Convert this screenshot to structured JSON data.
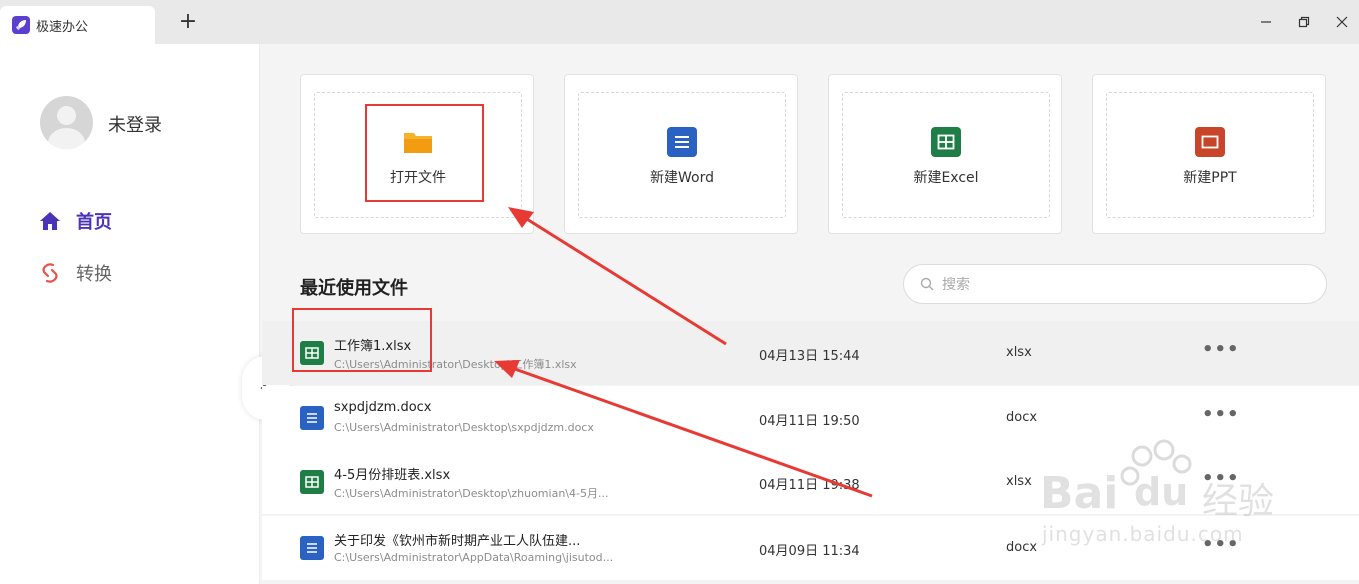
{
  "app": {
    "tab_title": "极速办公",
    "new_tab_label": "+"
  },
  "user": {
    "name": "未登录"
  },
  "nav": [
    {
      "label": "首页",
      "icon": "home-icon",
      "active": true
    },
    {
      "label": "转换",
      "icon": "convert-icon",
      "active": false
    }
  ],
  "cards": [
    {
      "label": "打开文件",
      "icon": "folder-icon",
      "color": "#f6a623"
    },
    {
      "label": "新建Word",
      "icon": "word-icon",
      "color": "#2a62c4"
    },
    {
      "label": "新建Excel",
      "icon": "excel-icon",
      "color": "#1e7e45"
    },
    {
      "label": "新建PPT",
      "icon": "ppt-icon",
      "color": "#c8452a"
    }
  ],
  "recent": {
    "title": "最近使用文件",
    "search_placeholder": "搜索",
    "files": [
      {
        "name": "工作簿1.xlsx",
        "path": "C:\\Users\\Administrator\\Desktop\\工作簿1.xlsx",
        "date": "04月13日 15:44",
        "type": "xlsx",
        "icon": "excel-file-icon",
        "more": "•••"
      },
      {
        "name": "sxpdjdzm.docx",
        "path": "C:\\Users\\Administrator\\Desktop\\sxpdjdzm.docx",
        "date": "04月11日 19:50",
        "type": "docx",
        "icon": "word-file-icon",
        "more": "•••"
      },
      {
        "name": "4-5月份排班表.xlsx",
        "path": "C:\\Users\\Administrator\\Desktop\\zhuomian\\4-5月...",
        "date": "04月11日 19:38",
        "type": "xlsx",
        "icon": "excel-file-icon",
        "more": "•••"
      },
      {
        "name": "关于印发《钦州市新时期产业工人队伍建...",
        "path": "C:\\Users\\Administrator\\AppData\\Roaming\\jisutod...",
        "date": "04月09日 11:34",
        "type": "docx",
        "icon": "word-file-icon",
        "more": "•••"
      }
    ]
  },
  "colors": {
    "accent": "#4b33b8",
    "highlight": "#e83a35",
    "excel": "#1e7e45",
    "word": "#2a62c4"
  },
  "watermark": {
    "brand_latin": "Bai",
    "brand_du": "du",
    "brand_cn": "经验",
    "url": "jingyan.baidu.com"
  }
}
